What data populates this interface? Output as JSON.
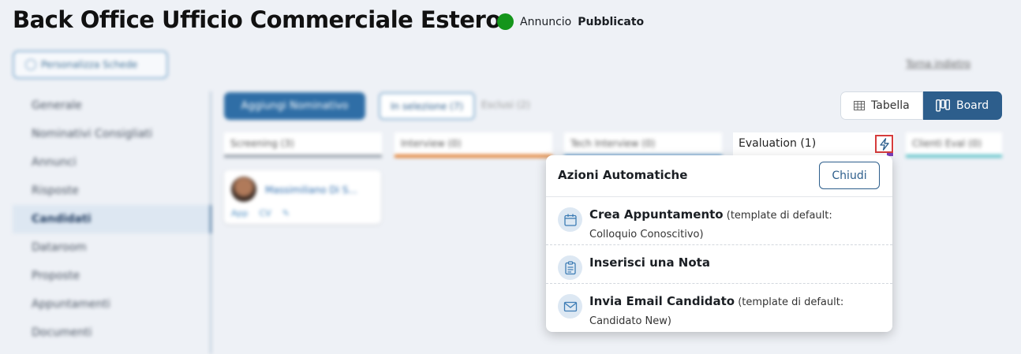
{
  "header": {
    "title": "Back Office Ufficio Commerciale Estero",
    "status_prefix": "Annuncio",
    "status_value": "Pubblicato",
    "status_color": "#14951b"
  },
  "toolbar": {
    "personalize_label": "Personalizza Schede",
    "back_link": "Torna indietro"
  },
  "sidebar": {
    "items": [
      {
        "label": "Generale"
      },
      {
        "label": "Nominativi Consigliati"
      },
      {
        "label": "Annunci"
      },
      {
        "label": "Risposte"
      },
      {
        "label": "Candidati",
        "active": true
      },
      {
        "label": "Dataroom"
      },
      {
        "label": "Proposte"
      },
      {
        "label": "Appuntamenti"
      },
      {
        "label": "Documenti"
      }
    ]
  },
  "board_toolbar": {
    "add_label": "Aggiungi Nominativo",
    "filter_in_selection": "In selezione (7)",
    "filter_excluded": "Esclusi (2)",
    "view_table": "Tabella",
    "view_board": "Board"
  },
  "columns": [
    {
      "label": "Screening (3)",
      "color": "#9aa3ad"
    },
    {
      "label": "Interview (0)",
      "color": "#e07b2c"
    },
    {
      "label": "Tech Interview (0)",
      "color": "#4a8bc0"
    },
    {
      "label": "Evaluation (1)",
      "color": "#7a3db8"
    },
    {
      "label": "Clienti Eval (0)",
      "color": "#5fc2c9"
    }
  ],
  "card": {
    "name": "Massimiliano Di S...",
    "app_label": "App",
    "cv_label": "CV"
  },
  "popup": {
    "title": "Azioni Automatiche",
    "close_label": "Chiudi",
    "actions": [
      {
        "title": "Crea Appuntamento",
        "detail": " (template di default: Colloquio Conoscitivo)",
        "icon": "calendar-icon"
      },
      {
        "title": "Inserisci una Nota",
        "detail": "",
        "icon": "note-icon"
      },
      {
        "title": "Invia Email Candidato",
        "detail": " (template di default: Candidato New)",
        "icon": "mail-icon"
      }
    ]
  }
}
